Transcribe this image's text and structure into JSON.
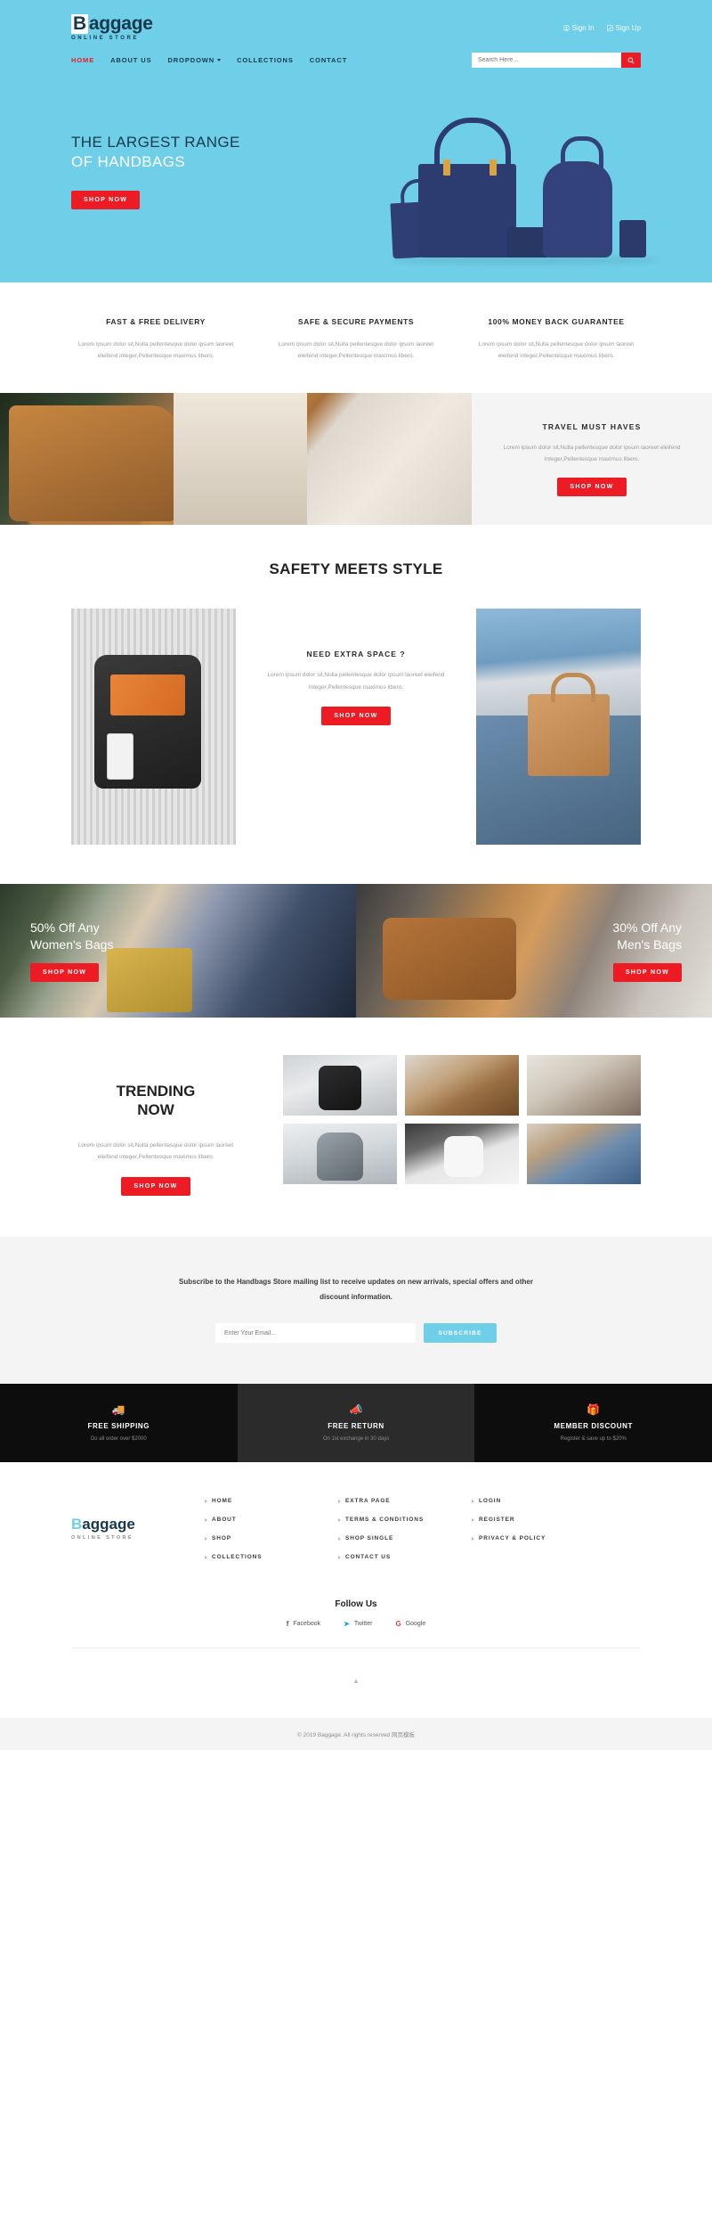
{
  "header": {
    "logo": {
      "cap": "B",
      "rest": "aggage",
      "sub": "ONLINE STORE"
    },
    "account": [
      {
        "label": "Sign In",
        "icon": "user-icon"
      },
      {
        "label": "Sign Up",
        "icon": "edit-icon"
      }
    ],
    "nav": [
      {
        "label": "HOME",
        "active": true
      },
      {
        "label": "ABOUT US",
        "active": false
      },
      {
        "label": "DROPDOWN",
        "active": false,
        "caret": true
      },
      {
        "label": "COLLECTIONS",
        "active": false
      },
      {
        "label": "CONTACT",
        "active": false
      }
    ],
    "search": {
      "placeholder": "Search Here...",
      "value": "",
      "icon": "search-icon"
    }
  },
  "hero": {
    "line1": "THE LARGEST RANGE",
    "line2": "OF HANDBAGS",
    "button": "SHOP NOW"
  },
  "features": [
    {
      "title": "FAST & FREE DELIVERY",
      "body": "Lorem ipsum dolor sit,Nulla pellentesque dolor ipsum laoreet eleifend integer,Pellentesque maximus libero."
    },
    {
      "title": "SAFE & SECURE PAYMENTS",
      "body": "Lorem ipsum dolor sit,Nulla pellentesque dolor ipsum laoreet eleifend integer,Pellentesque maximus libero."
    },
    {
      "title": "100% MONEY BACK GUARANTEE",
      "body": "Lorem ipsum dolor sit,Nulla pellentesque dolor ipsum laoreet eleifend integer,Pellentesque maximus libero."
    }
  ],
  "travel": {
    "title": "TRAVEL MUST HAVES",
    "body": "Lorem ipsum dolor sit,Nulla pellentesque dolor ipsum laoreet eleifend Integer,Pellentesque maximus libero.",
    "button": "SHOP NOW"
  },
  "safety": {
    "title": "SAFETY MEETS STYLE",
    "card": {
      "title": "NEED EXTRA SPACE ?",
      "body": "Lorem ipsum dolor sit,Nulla pellentesque dolor ipsum laoreet eleifend Integer,Pellentesque maximus libero.",
      "button": "SHOP NOW"
    }
  },
  "promos": [
    {
      "line1": "50% Off Any",
      "line2": "Women's Bags",
      "button": "SHOP NOW"
    },
    {
      "line1": "30% Off Any",
      "line2": "Men's Bags",
      "button": "SHOP NOW"
    }
  ],
  "trending": {
    "title_line1": "TRENDING",
    "title_line2": "NOW",
    "body": "Lorem ipsum dolor sit,Nulla pellentesque dolor ipsum laoreet eleifend integer,Pellentesque maximus libero.",
    "button": "SHOP NOW",
    "thumbnails": [
      "black-backpack-thumb",
      "tan-duffel-thumb",
      "leather-handbag-thumb",
      "grey-backpack-thumb",
      "white-bag-thumb",
      "denim-bag-thumb"
    ]
  },
  "newsletter": {
    "text": "Subscribe to the Handbags Store mailing list to receive updates on new arrivals, special offers and other discount information.",
    "input_placeholder": "Enter Your Email...",
    "input_value": "",
    "button": "SUBSCRIBE"
  },
  "services": [
    {
      "icon": "truck-icon",
      "glyph": "🚚",
      "title": "FREE SHIPPING",
      "sub": "Do all order over $2000"
    },
    {
      "icon": "megaphone-icon",
      "glyph": "📣",
      "title": "FREE RETURN",
      "sub": "On 1st exchange in 30 days"
    },
    {
      "icon": "gift-icon",
      "glyph": "🎁",
      "title": "MEMBER DISCOUNT",
      "sub": "Register & save up to $20%"
    }
  ],
  "footer": {
    "logo": {
      "cap": "B",
      "rest": "aggage",
      "sub": "ONLINE STORE"
    },
    "columns": [
      [
        "HOME",
        "ABOUT",
        "SHOP",
        "COLLECTIONS"
      ],
      [
        "EXTRA PAGE",
        "TERMS & CONDITIONS",
        "SHOP SINGLE",
        "CONTACT US"
      ],
      [
        "LOGIN",
        "REGISTER",
        "PRIVACY & POLICY"
      ]
    ],
    "follow_title": "Follow Us",
    "socials": [
      {
        "label": "Facebook",
        "glyph": "f",
        "icon": "facebook-icon"
      },
      {
        "label": "Twitter",
        "glyph": "➤",
        "icon": "twitter-icon"
      },
      {
        "label": "Google",
        "glyph": "G",
        "icon": "google-icon"
      }
    ],
    "back_to_top": "▲",
    "copyright": "© 2019 Baggage. All rights reserved 网页模板"
  },
  "colors": {
    "brand": "#6fcfe8",
    "accent": "#ed1c24",
    "dark": "#17384d"
  }
}
